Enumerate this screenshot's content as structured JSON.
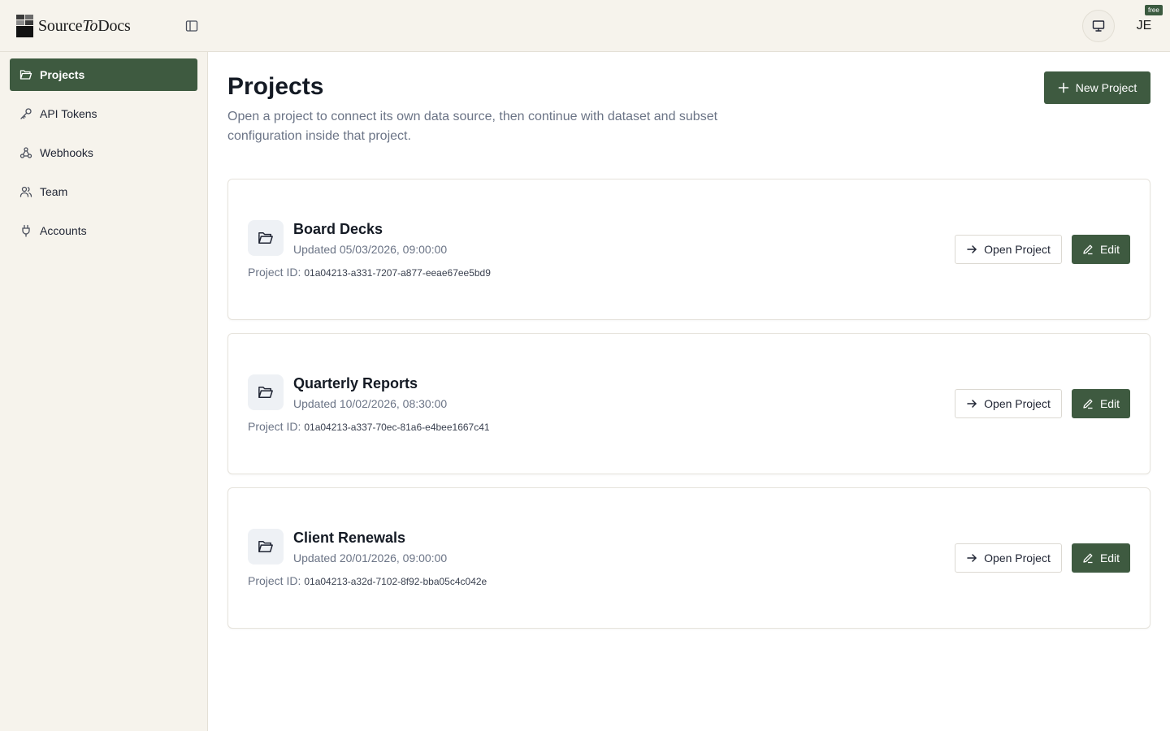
{
  "brand": {
    "name_prefix": "Source",
    "name_italic": "To",
    "name_suffix": "Docs"
  },
  "header": {
    "user_initials": "JE",
    "plan_badge": "free",
    "display_icon": "monitor-icon",
    "toggle_icon": "sidebar-toggle-icon"
  },
  "sidebar": {
    "items": [
      {
        "label": "Projects",
        "icon": "folder-open-icon",
        "active": true
      },
      {
        "label": "API Tokens",
        "icon": "key-icon",
        "active": false
      },
      {
        "label": "Webhooks",
        "icon": "webhook-icon",
        "active": false
      },
      {
        "label": "Team",
        "icon": "users-icon",
        "active": false
      },
      {
        "label": "Accounts",
        "icon": "plug-icon",
        "active": false
      }
    ]
  },
  "main": {
    "title": "Projects",
    "description": "Open a project to connect its own data source, then continue with dataset and subset configuration inside that project.",
    "new_project_label": "New Project",
    "id_label": "Project ID:",
    "open_label": "Open Project",
    "edit_label": "Edit",
    "projects": [
      {
        "name": "Board Decks",
        "updated": "Updated 05/03/2026, 09:00:00",
        "id": "01a04213-a331-7207-a877-eeae67ee5bd9"
      },
      {
        "name": "Quarterly Reports",
        "updated": "Updated 10/02/2026, 08:30:00",
        "id": "01a04213-a337-70ec-81a6-e4bee1667c41"
      },
      {
        "name": "Client Renewals",
        "updated": "Updated 20/01/2026, 09:00:00",
        "id": "01a04213-a32d-7102-8f92-bba05c4c042e"
      }
    ]
  },
  "colors": {
    "accent": "#3e5a40",
    "sidebar_bg": "#f6f3ec",
    "muted_text": "#6b7486"
  }
}
